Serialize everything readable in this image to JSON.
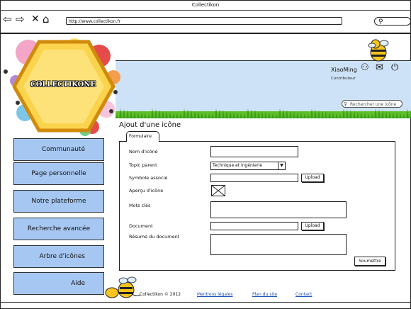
{
  "window": {
    "title": "Collectikon"
  },
  "browser": {
    "url": "http://www.collectikon.fr"
  },
  "logo": {
    "text": "COLLECTIKONE"
  },
  "header": {
    "username": "XiaoMing",
    "role": "Contributeur",
    "search_placeholder": "Rechercher une icône"
  },
  "sidebar": {
    "items": [
      {
        "label": "Communauté"
      },
      {
        "label": "Page personnelle"
      },
      {
        "label": "Notre plateforme"
      },
      {
        "label": "Recherche avancée"
      },
      {
        "label": "Arbre d'icônes"
      },
      {
        "label": "Aide"
      }
    ]
  },
  "main": {
    "title": "Ajout d'une icône",
    "tab": "Formulaire",
    "form": {
      "name_label": "Nom d'icône",
      "topic_label": "Topic parent",
      "topic_value": "Technique et ingénierie",
      "symbol_label": "Symbole associé",
      "preview_label": "Aperçu d'icône",
      "keywords_label": "Mots clés",
      "document_label": "Document",
      "summary_label": "Résumé du document",
      "upload_label": "Upload",
      "submit_label": "Soumettre"
    }
  },
  "footer": {
    "copyright": "Collectikon © 2012",
    "links": [
      "Mentions légales",
      "Plan du site",
      "Contact"
    ]
  }
}
